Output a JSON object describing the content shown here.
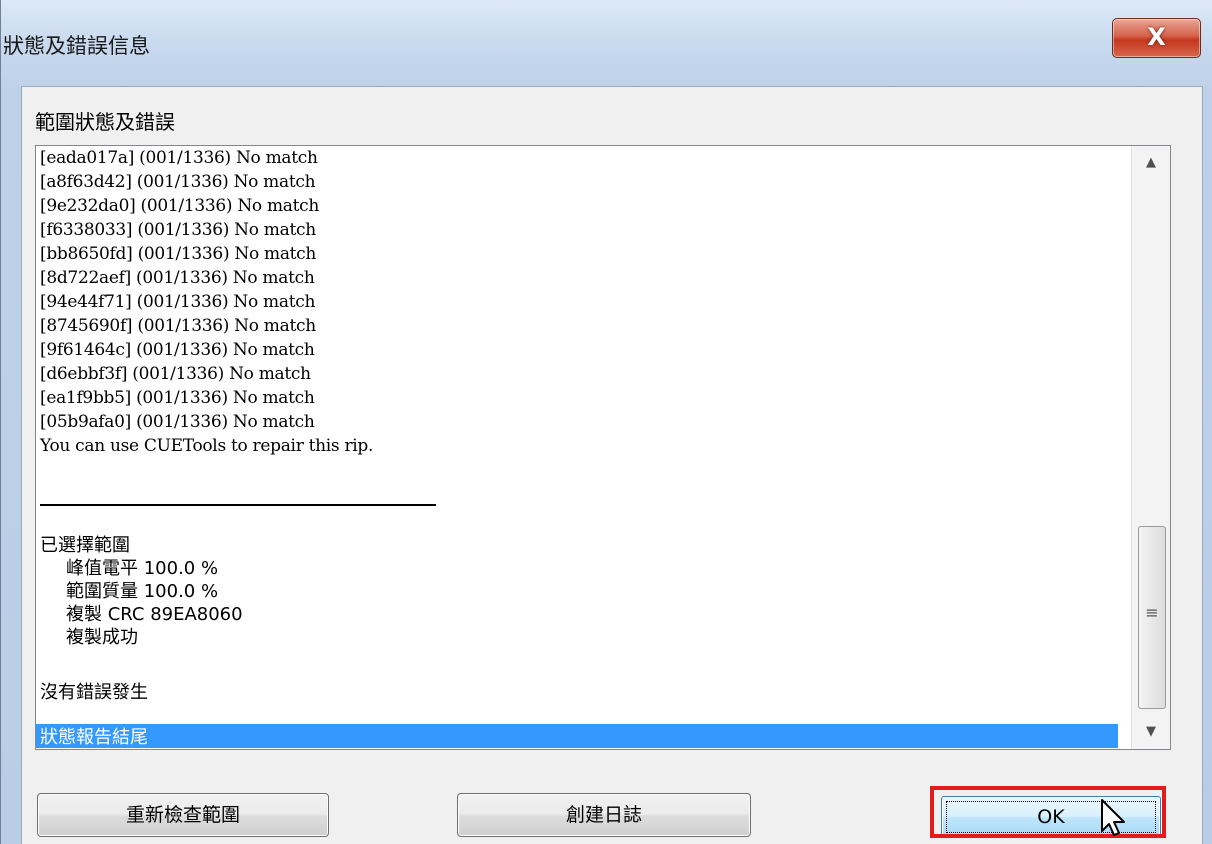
{
  "window": {
    "title": "狀態及錯誤信息",
    "close_label": "X",
    "close_icon": "close-icon"
  },
  "group_label": "範圍狀態及錯誤",
  "log": {
    "lines": [
      "[eada017a] (001/1336) No match",
      "[a8f63d42] (001/1336) No match",
      "[9e232da0] (001/1336) No match",
      "[f6338033] (001/1336) No match",
      "[bb8650fd] (001/1336) No match",
      "[8d722aef] (001/1336) No match",
      "[94e44f71] (001/1336) No match",
      "[8745690f] (001/1336) No match",
      "[9f61464c] (001/1336) No match",
      "[d6ebbf3f] (001/1336) No match",
      "[ea1f9bb5] (001/1336) No match",
      "[05b9afa0] (001/1336) No match",
      "You can use CUETools to repair this rip."
    ],
    "selected_range_header": "已選擇範圍",
    "details": [
      "峰值電平 100.0 %",
      "範圍質量 100.0 %",
      "複製 CRC 89EA8060",
      "複製成功"
    ],
    "no_errors": "沒有錯誤發生",
    "end_of_report": "狀態報告結尾"
  },
  "scrollbar": {
    "up_icon": "scroll-up-arrow-icon",
    "down_icon": "scroll-down-arrow-icon",
    "grip_icon": "scroll-grip-icon"
  },
  "buttons": {
    "recheck": "重新檢查範圍",
    "create_log": "創建日誌",
    "ok": "OK"
  },
  "colors": {
    "selection": "#3399ff",
    "highlight_box": "#e31b1b",
    "close_button": "#c4381f"
  }
}
